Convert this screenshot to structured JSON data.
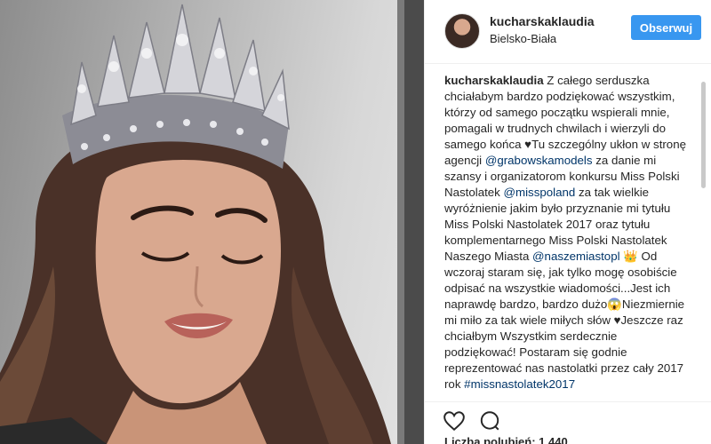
{
  "post": {
    "username": "kucharskaklaudia",
    "location": "Bielsko-Biała",
    "follow_label": "Obserwuj"
  },
  "caption": {
    "username": "kucharskaklaudia",
    "text_1": " Z całego serduszka chciałabym bardzo podziękować wszystkim, którzy od samego początku wspierali mnie, pomagali w trudnych chwilach i wierzyli do samego końca ♥Tu szczególny ukłon w stronę agencji ",
    "mention_1": "@grabowskamodels",
    "text_2": " za danie mi szansy i organizatorom konkursu Miss Polski Nastolatek ",
    "mention_2": "@misspoland",
    "text_3": " za tak wielkie wyróżnienie jakim było przyznanie mi tytułu Miss Polski Nastolatek 2017 oraz tytułu komplementarnego Miss Polski Nastolatek Naszego Miasta ",
    "mention_3": "@naszemiastopl",
    "text_4": " 👑 Od wczoraj staram się, jak tylko mogę osobiście odpisać na wszystkie wiadomości...Jest ich naprawdę bardzo, bardzo dużo😱Niezmiernie mi miło za tak wiele miłych słów ♥Jeszcze raz chciałbym Wszystkim serdecznie podziękować! Postaram się godnie reprezentować nas nastolatki przez cały 2017 rok ",
    "mention_4": "#missnastolatek2017"
  },
  "actions": {
    "like_icon": "heart-icon",
    "comment_icon": "comment-icon"
  },
  "likes_text": "Liczba polubień: 1 440",
  "colors": {
    "follow_button": "#3897f0",
    "link": "#003569",
    "text": "#262626",
    "border": "#efefef"
  }
}
